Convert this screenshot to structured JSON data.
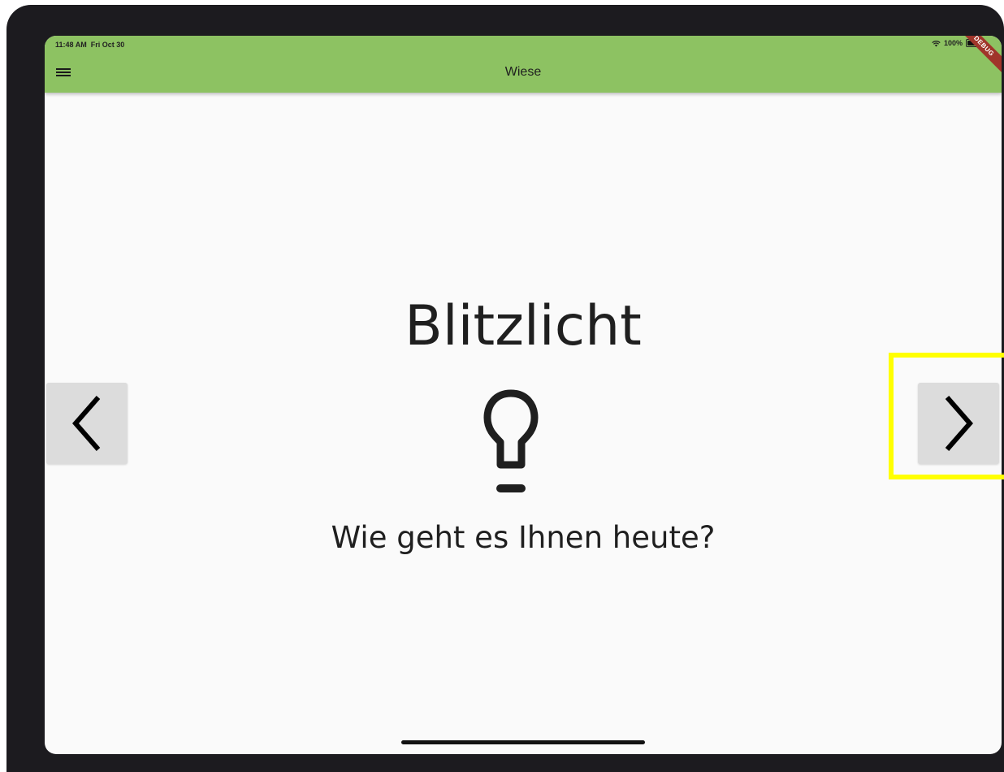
{
  "status_bar": {
    "time": "11:48 AM",
    "date": "Fri Oct 30",
    "battery": "100%"
  },
  "app_bar": {
    "title": "Wiese",
    "menu_icon": "hamburger-menu-icon",
    "debug_banner": "DEBUG",
    "color": "#8dc262"
  },
  "content": {
    "title": "Blitzlicht",
    "icon": "lightbulb-icon",
    "question": "Wie geht es Ihnen heute?"
  },
  "navigation": {
    "prev_icon": "chevron-left-icon",
    "next_icon": "chevron-right-icon"
  },
  "colors": {
    "accent": "#8dc262",
    "highlight": "#ffff00",
    "button_bg": "#dcdcdc"
  }
}
